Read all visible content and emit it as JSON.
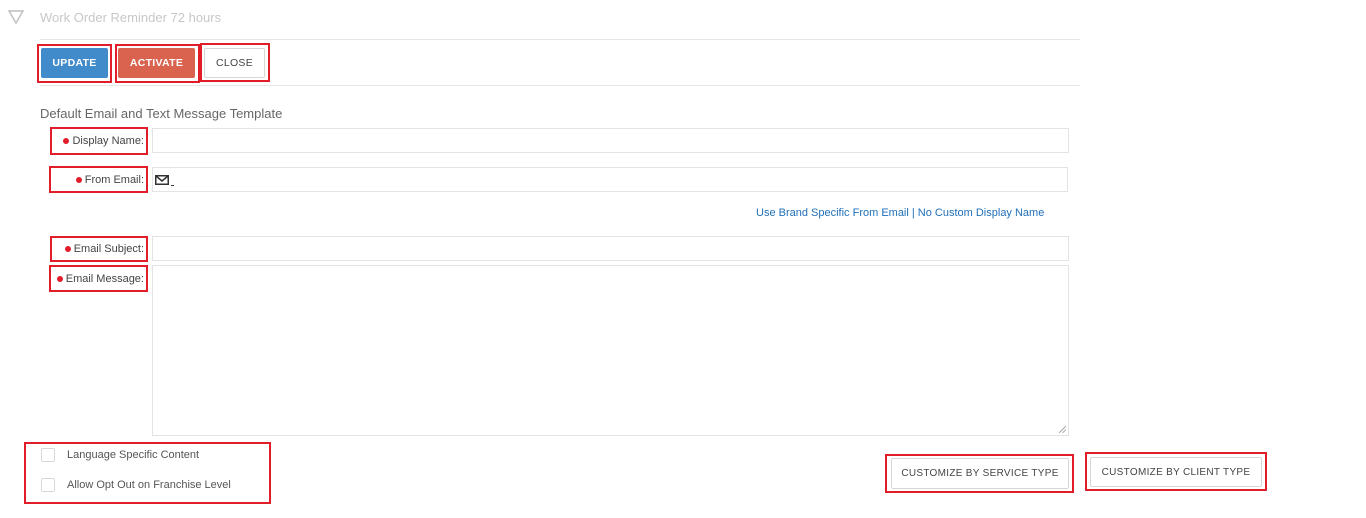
{
  "header": {
    "title": "Work Order Reminder 72 hours",
    "collapse_icon": "triangle-down-icon"
  },
  "toolbar": {
    "update_label": "UPDATE",
    "activate_label": "ACTIVATE",
    "close_label": "CLOSE"
  },
  "colors": {
    "primary": "#428bca",
    "danger": "#d9634f",
    "highlight": "#e11d2a",
    "link": "#1f6fb8"
  },
  "template": {
    "section_title": "Default Email and Text Message Template",
    "display_name": {
      "label": "Display Name:",
      "value": ""
    },
    "from_email": {
      "label": "From Email:",
      "value": "",
      "icon": "envelope-icon"
    },
    "brand_link": "Use Brand Specific From Email | No Custom Display Name",
    "email_subject": {
      "label": "Email Subject:",
      "value": ""
    },
    "email_message": {
      "label": "Email Message:",
      "value": ""
    }
  },
  "options": {
    "language_specific": {
      "label": "Language Specific Content",
      "checked": false
    },
    "opt_out": {
      "label": "Allow Opt Out on Franchise Level",
      "checked": false
    }
  },
  "customize": {
    "service_type_label": "CUSTOMIZE BY SERVICE TYPE",
    "client_type_label": "CUSTOMIZE BY CLIENT TYPE"
  }
}
